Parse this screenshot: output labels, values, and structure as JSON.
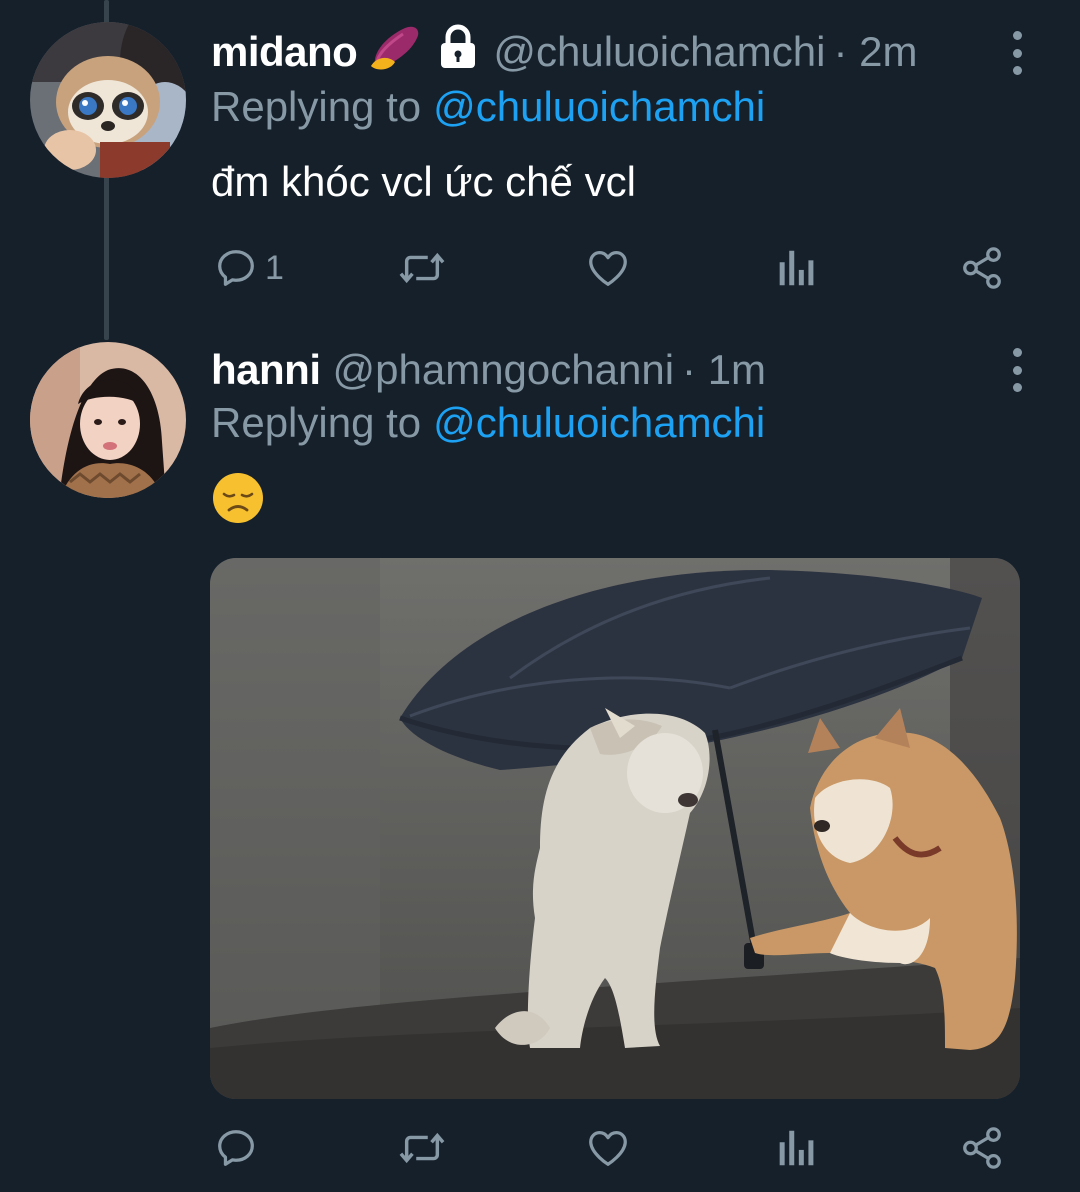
{
  "tweets": [
    {
      "display_name": "midano",
      "handle": "@chuluoichamchi",
      "time": "· 2m",
      "reply_prefix": "Replying to",
      "reply_to": "@chuluoichamchi",
      "text": "đm khóc vcl ức chế vcl",
      "reply_count": "1",
      "avatar": "plush-sloth-avatar"
    },
    {
      "display_name": "hanni",
      "handle": "@phamngochanni",
      "time": "· 1m",
      "reply_prefix": "Replying to",
      "reply_to": "@chuluoichamchi",
      "text": "",
      "reply_count": "",
      "emoji": "disappointed-face-emoji",
      "avatar": "girl-portrait-avatar",
      "media": "two dogs sharing an umbrella in the rain"
    }
  ],
  "icons": {
    "reply": "reply-icon",
    "retweet": "retweet-icon",
    "like": "like-icon",
    "views": "views-icon",
    "share": "share-icon",
    "more": "more-icon",
    "lock": "lock-icon",
    "sweet-potato": "sweet-potato-emoji"
  },
  "colors": {
    "background": "#15202b",
    "secondary_text": "#8899a6",
    "accent": "#1da1f2",
    "thread_line": "#38444d"
  }
}
